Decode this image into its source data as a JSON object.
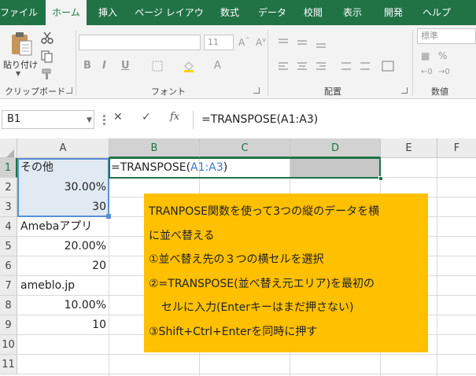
{
  "ribbon": {
    "tabs": [
      {
        "label": "ファイル",
        "active": false
      },
      {
        "label": "ホーム",
        "active": true
      },
      {
        "label": "挿入",
        "active": false
      },
      {
        "label": "ページ レイアウト",
        "active": false
      },
      {
        "label": "数式",
        "active": false
      },
      {
        "label": "データ",
        "active": false
      },
      {
        "label": "校閲",
        "active": false
      },
      {
        "label": "表示",
        "active": false
      },
      {
        "label": "開発",
        "active": false
      },
      {
        "label": "ヘルプ",
        "active": false
      }
    ],
    "clipboard": {
      "paste_label": "貼り付け",
      "group_label": "クリップボード"
    },
    "font": {
      "font_size": "11",
      "group_label": "フォント",
      "bold": "B",
      "italic": "I",
      "underline": "U"
    },
    "alignment": {
      "group_label": "配置"
    },
    "number": {
      "format": "標準",
      "group_label": "数値"
    }
  },
  "formula_bar": {
    "name_box": "B1",
    "formula": "=TRANSPOSE(A1:A3)"
  },
  "grid": {
    "columns": [
      "A",
      "B",
      "C",
      "D",
      "E",
      "F"
    ],
    "rows": [
      "1",
      "2",
      "3",
      "4",
      "5",
      "6",
      "7",
      "8",
      "9",
      "10",
      "11"
    ],
    "cells_A": [
      "その他",
      "30.00%",
      "30",
      "Amebaアプリ",
      "20.00%",
      "20",
      "ameblo.jp",
      "10.00%",
      "10",
      "",
      ""
    ],
    "edit_formula_prefix": "=TRANSPOSE(",
    "edit_formula_ref": "A1:A3",
    "edit_formula_suffix": ")"
  },
  "note": {
    "lines": [
      "TRANPOSE関数を使って3つの縦のデータを横",
      "に並べ替える",
      "①並べ替え先の３つの横セルを選択",
      "②=TRANSPOSE(並べ替え元エリア)を最初の",
      "セルに入力(Enterキーはまだ押さない)",
      "③Shift+Ctrl+Enterを同時に押す"
    ]
  },
  "colors": {
    "excel_green": "#217346",
    "ref_blue": "#5b8fd6",
    "note_bg": "#ffc000"
  }
}
